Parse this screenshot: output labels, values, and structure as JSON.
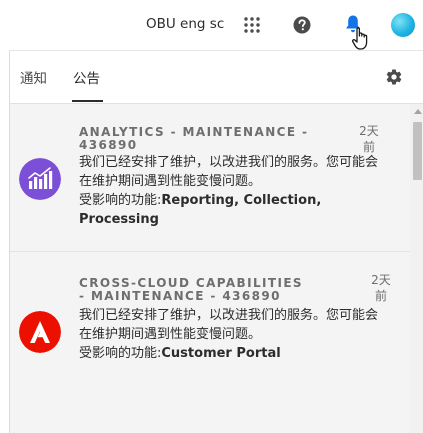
{
  "header": {
    "org_name": "OBU eng sc",
    "icons": [
      "apps-grid-icon",
      "help-icon",
      "bell-icon",
      "avatar"
    ],
    "accent": "#1473e6"
  },
  "panel": {
    "tabs": [
      {
        "label": "通知",
        "active": false
      },
      {
        "label": "公告",
        "active": true
      }
    ],
    "settings_icon": "gear-icon"
  },
  "announcements": [
    {
      "icon": "analytics-icon",
      "icon_color": "#7b4fd6",
      "title": "ANALYTICS - MAINTENANCE - 436890",
      "time": "2天前",
      "message": "我们已经安排了维护，以改进我们的服务。您可能会在维护期间遇到性能变慢问题。",
      "affected_prefix": "受影响的功能:",
      "affected_features": "Reporting, Collection, Processing"
    },
    {
      "icon": "adobe-logo-icon",
      "icon_color": "#eb1000",
      "title": "CROSS-CLOUD CAPABILITIES - MAINTENANCE - 436890",
      "time": "2天前",
      "message": "我们已经安排了维护，以改进我们的服务。您可能会在维护期间遇到性能变慢问题。",
      "affected_prefix": "受影响的功能:",
      "affected_features": "Customer Portal"
    }
  ]
}
